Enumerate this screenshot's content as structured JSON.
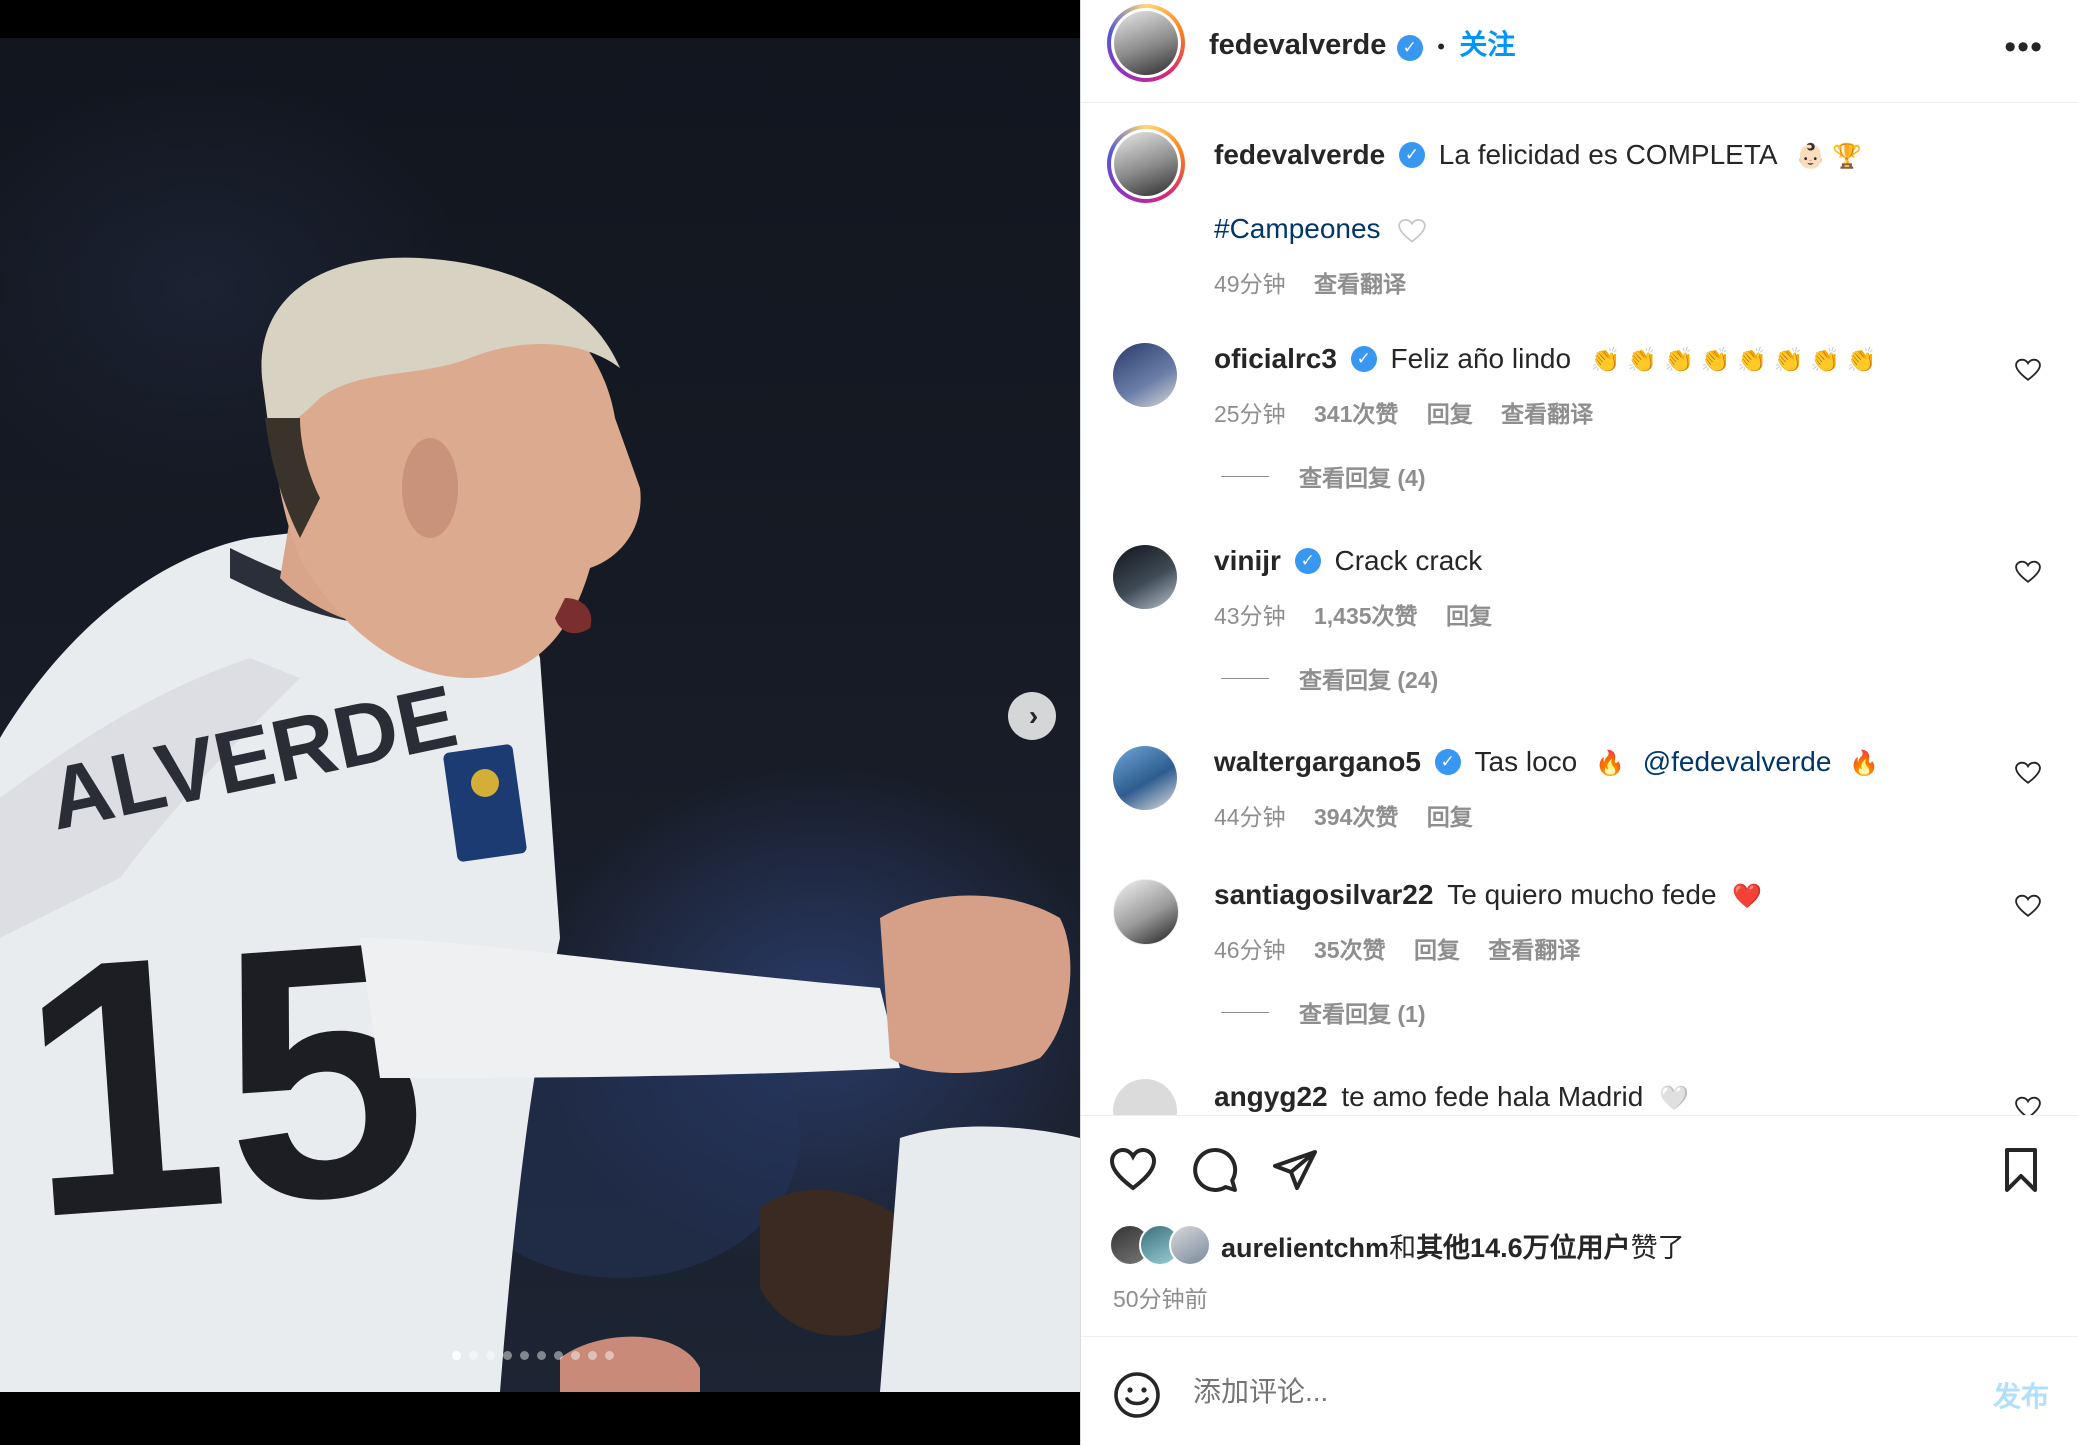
{
  "post": {
    "author": "fedevalverde",
    "follow_label": "关注",
    "separator": "•",
    "more_label": "•••",
    "caption_text": "La felicidad es COMPLETA",
    "caption_emoji": "👶🏻 🏆",
    "hashtag": "#Campeones",
    "caption_time": "49分钟",
    "caption_translate": "查看翻译"
  },
  "comments": [
    {
      "user": "oficialrc3",
      "verified": true,
      "text": "Feliz año lindo",
      "emoji": "👏 👏 👏 👏 👏 👏 👏 👏",
      "time": "25分钟",
      "likes": "341次赞",
      "reply": "回复",
      "translate": "查看翻译",
      "view_replies": "查看回复 (4)"
    },
    {
      "user": "vinijr",
      "verified": true,
      "text": "Crack crack",
      "time": "43分钟",
      "likes": "1,435次赞",
      "reply": "回复",
      "view_replies": "查看回复 (24)"
    },
    {
      "user": "waltergargano5",
      "verified": true,
      "text": "Tas loco",
      "emoji_a": "🔥",
      "mention": "@fedevalverde",
      "emoji_b": "🔥",
      "time": "44分钟",
      "likes": "394次赞",
      "reply": "回复"
    },
    {
      "user": "santiagosilvar22",
      "verified": false,
      "text": "Te quiero mucho fede",
      "emoji": "❤️",
      "time": "46分钟",
      "likes": "35次赞",
      "reply": "回复",
      "translate": "查看翻译",
      "view_replies": "查看回复 (1)"
    },
    {
      "user": "angyg22",
      "verified": false,
      "text": "te amo fede hala Madrid",
      "emoji": "🤍"
    }
  ],
  "actions": {
    "liked_by_user": "aurelientchm",
    "liked_by_mid": "和",
    "liked_by_others": "其他14.6万位用户",
    "liked_by_suffix": "赞了",
    "post_time": "50分钟前"
  },
  "comment_box": {
    "placeholder": "添加评论...",
    "post_label": "发布"
  },
  "media": {
    "next_label": "›",
    "slide_count": 10,
    "active_slide": 0
  },
  "colors": {
    "link_blue": "#0095f6",
    "verified_blue": "#3897f0",
    "hashtag_blue": "#00376b",
    "muted_gray": "#8e8e8e",
    "post_button_disabled": "#b2dffc"
  }
}
